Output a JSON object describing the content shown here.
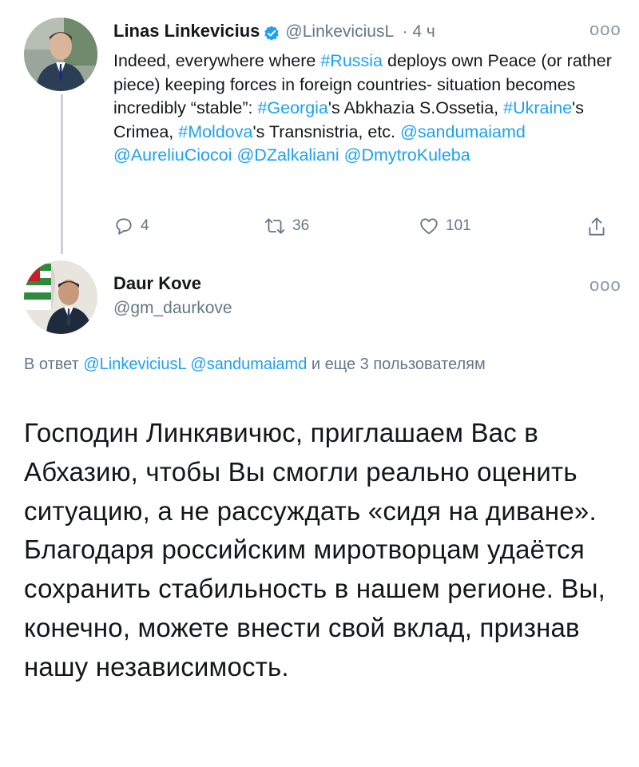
{
  "tweet1": {
    "name": "Linas Linkevicius",
    "handle": "@LinkeviciusL",
    "time": "· 4 ч",
    "more": "ooo",
    "text_parts": {
      "p1": "Indeed, everywhere where ",
      "h_russia": "#Russia",
      "p2": " deploys own Peace (or rather piece) keeping forces in foreign countries- situation becomes incredibly “stable”: ",
      "h_georgia": "#Georgia",
      "p3": "'s Abkhazia S.Ossetia, ",
      "h_ukraine": "#Ukraine",
      "p4": "'s Crimea, ",
      "h_moldova": "#Moldova",
      "p5": "'s Transnistria, etc. ",
      "m_sandu": "@sandumaiamd",
      "m_aureliu": "@AureliuCiocoi",
      "m_dzalk": "@DZalkaliani",
      "m_kuleba": "@DmytroKuleba"
    },
    "actions": {
      "replies": "4",
      "retweets": "36",
      "likes": "101"
    }
  },
  "tweet2": {
    "name": "Daur Kove",
    "handle": "@gm_daurkove",
    "more": "ooo",
    "reply_prefix": "В ответ ",
    "reply_user1": "@LinkeviciusL",
    "reply_user2": "@sandumaiamd",
    "reply_suffix": " и еще 3 пользователям",
    "text": "Господин Линкявичюс,  приглашаем Вас в Абхазию, чтобы Вы смогли реально оценить ситуацию, а не рассуждать «сидя на диване». Благодаря российским миротворцам удаётся сохранить стабильность в нашем регионе. Вы, конечно, можете внести свой вклад, признав нашу независимость."
  },
  "colors": {
    "link": "#1da1f2",
    "muted": "#657786",
    "text": "#14171a",
    "thread_line": "#c9d1d8"
  },
  "icons": [
    "reply-icon",
    "retweet-icon",
    "like-icon",
    "share-icon",
    "verified-badge-icon",
    "more-options-icon"
  ]
}
